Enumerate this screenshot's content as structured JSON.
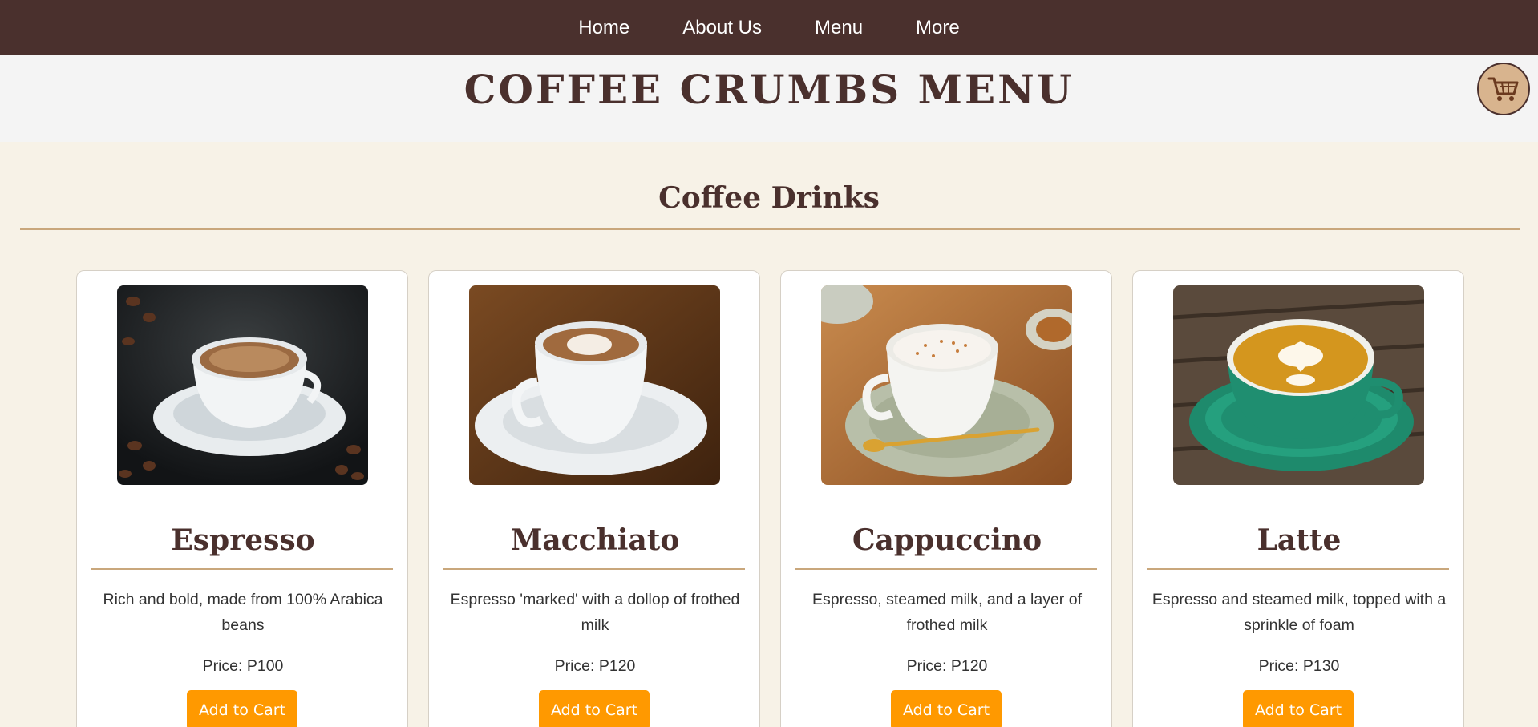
{
  "nav": {
    "items": [
      {
        "label": "Home"
      },
      {
        "label": "About Us"
      },
      {
        "label": "Menu"
      },
      {
        "label": "More"
      }
    ]
  },
  "header": {
    "title": "COFFEE CRUMBS MENU",
    "cart_icon": "shopping-cart-icon"
  },
  "section": {
    "title": "Coffee Drinks"
  },
  "products": [
    {
      "name": "Espresso",
      "description": "Rich and bold, made from 100% Arabica beans",
      "price": "Price: P100",
      "button": "Add to Cart",
      "image": "espresso-photo"
    },
    {
      "name": "Macchiato",
      "description": "Espresso 'marked' with a dollop of frothed milk",
      "price": "Price: P120",
      "button": "Add to Cart",
      "image": "macchiato-photo"
    },
    {
      "name": "Cappuccino",
      "description": "Espresso, steamed milk, and a layer of frothed milk",
      "price": "Price: P120",
      "button": "Add to Cart",
      "image": "cappuccino-photo"
    },
    {
      "name": "Latte",
      "description": "Espresso and steamed milk, topped with a sprinkle of foam",
      "price": "Price: P130",
      "button": "Add to Cart",
      "image": "latte-photo"
    }
  ],
  "colors": {
    "nav_bg": "#4a302d",
    "heading": "#4a302d",
    "accent_rule": "#c9a77c",
    "button": "#ff9900",
    "page_bg": "#f7f2e7"
  }
}
